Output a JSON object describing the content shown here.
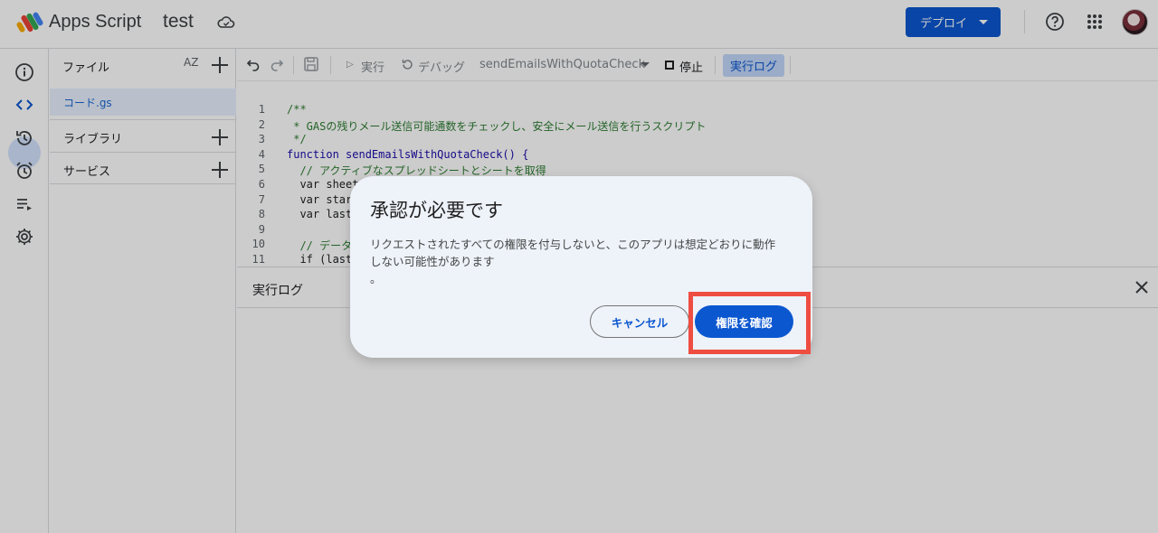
{
  "header": {
    "app_name": "Apps Script",
    "project_name": "test",
    "deploy_label": "デプロイ",
    "icons": [
      "apps-script-logo-icon",
      "cloud-icon",
      "help-icon",
      "apps-grid-icon",
      "avatar"
    ]
  },
  "rail": {
    "items": [
      "info-icon",
      "code-icon",
      "history-icon",
      "trigger-icon",
      "executions-icon",
      "settings-icon"
    ],
    "active": "code-icon"
  },
  "files_panel": {
    "header": "ファイル",
    "sort_label": "AZ",
    "file": "コード.gs",
    "sections": [
      "ライブラリ",
      "サービス"
    ]
  },
  "toolbar": {
    "run": "実行",
    "debug": "デバッグ",
    "function": "sendEmailsWithQuotaCheck",
    "stop": "停止",
    "exec_log": "実行ログ"
  },
  "code": {
    "lines": [
      {
        "n": "1",
        "text": "/**"
      },
      {
        "n": "2",
        "text": " * GASの残りメール送信可能通数をチェックし、安全にメール送信を行うスクリプト"
      },
      {
        "n": "3",
        "text": " */"
      },
      {
        "n": "4",
        "text": "function sendEmailsWithQuotaCheck() {"
      },
      {
        "n": "5",
        "text": "  // アクティブなスプレッドシートとシートを取得"
      },
      {
        "n": "6",
        "text": "  var sheet"
      },
      {
        "n": "7",
        "text": "  var star"
      },
      {
        "n": "8",
        "text": "  var last"
      },
      {
        "n": "9",
        "text": ""
      },
      {
        "n": "10",
        "text": "  // データ"
      },
      {
        "n": "11",
        "text": "  if (last"
      }
    ]
  },
  "log_panel": {
    "title": "実行ログ"
  },
  "dialog": {
    "title": "承認が必要です",
    "body_line1": "リクエストされたすべての権限を付与しないと、このアプリは想定どおりに動作",
    "body_line2": "しない可能性があります",
    "body_line3": "。",
    "cancel": "キャンセル",
    "confirm": "権限を確認",
    "highlight_color": "#ee4d41"
  },
  "colors": {
    "primary": "#0b57d0",
    "selection": "#e8f0fe"
  }
}
